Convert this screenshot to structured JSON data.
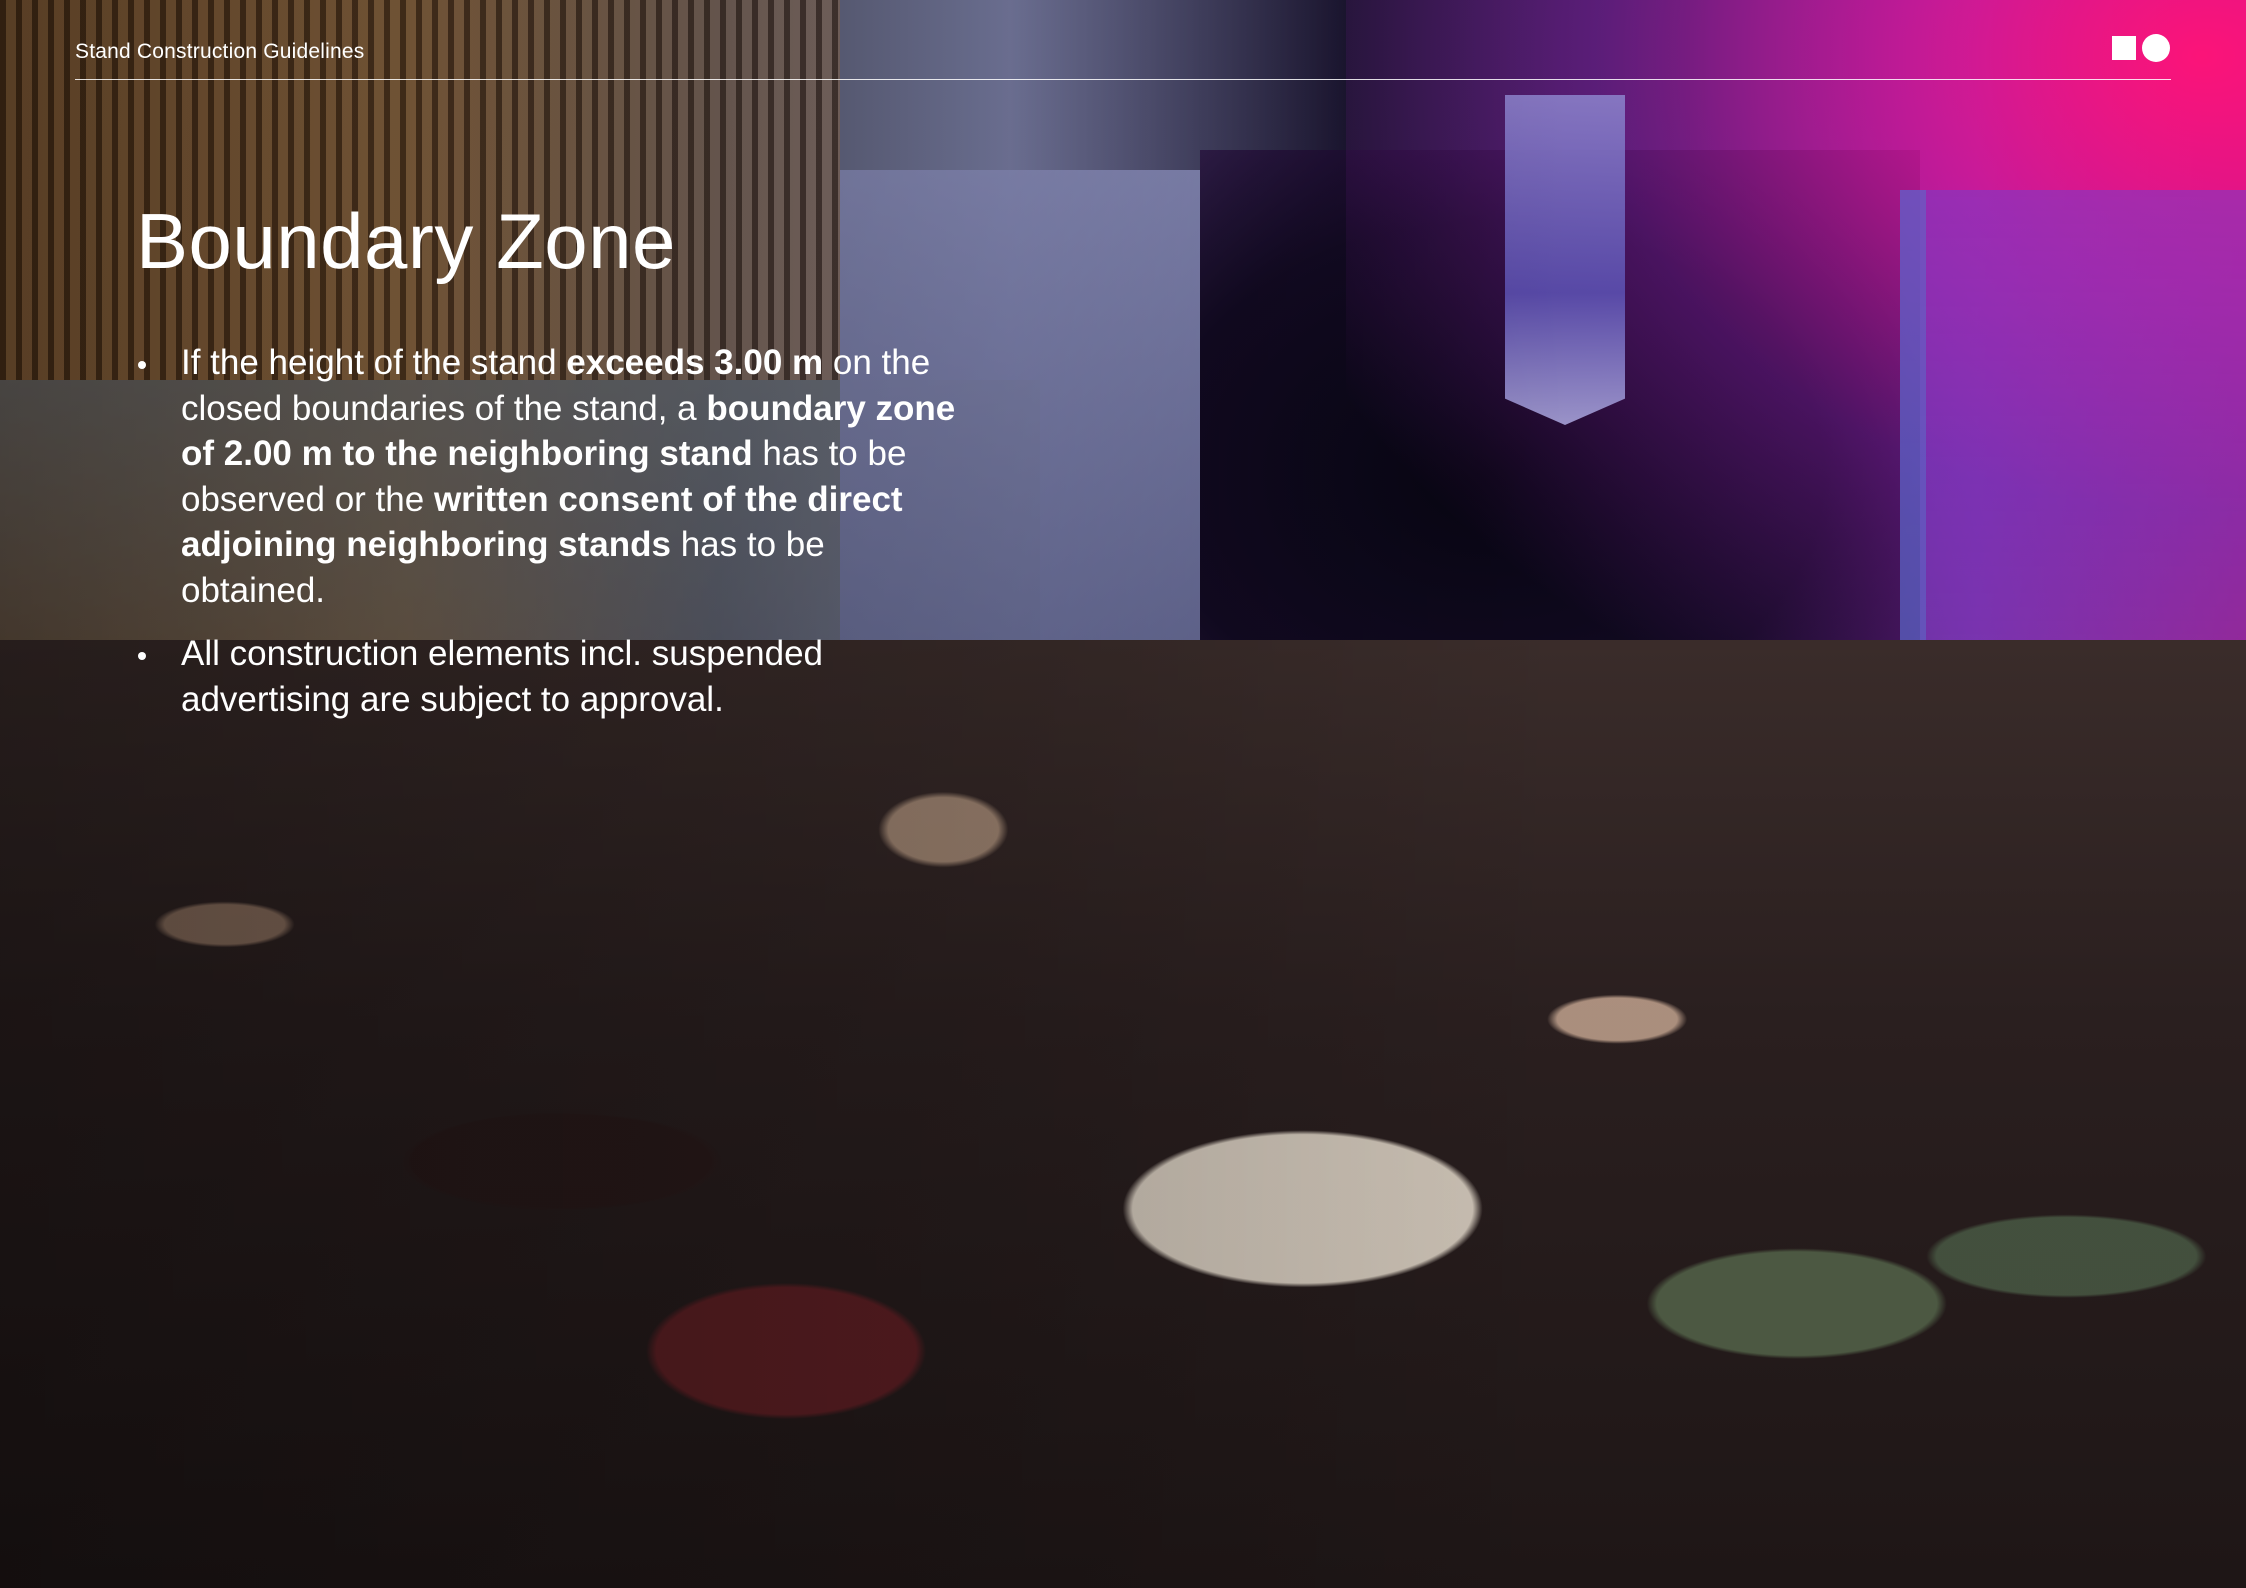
{
  "header": {
    "label": "Stand Construction Guidelines",
    "logo_icon": "square-circle-logo-icon"
  },
  "page": {
    "title": "Boundary Zone",
    "background_photo": "crowd-trade-fair-hall-photo",
    "bullets": [
      {
        "segments": [
          {
            "text": "If the height of the stand ",
            "bold": false
          },
          {
            "text": "exceeds 3.00 m",
            "bold": true
          },
          {
            "text": " on the closed boundaries of the stand, a ",
            "bold": false
          },
          {
            "text": "boundary zone of 2.00 m to the neighboring stand",
            "bold": true
          },
          {
            "text": " has to be observed or the ",
            "bold": false
          },
          {
            "text": "written consent of the direct adjoining neighboring stands",
            "bold": true
          },
          {
            "text": " has to be obtained.",
            "bold": false
          }
        ]
      },
      {
        "segments": [
          {
            "text": "All construction elements incl. suspended advertising are subject to approval.",
            "bold": false
          }
        ]
      }
    ]
  },
  "colors": {
    "text": "#ffffff",
    "accent_magenta": "#ff1478",
    "accent_purple": "#8b2aa8"
  }
}
